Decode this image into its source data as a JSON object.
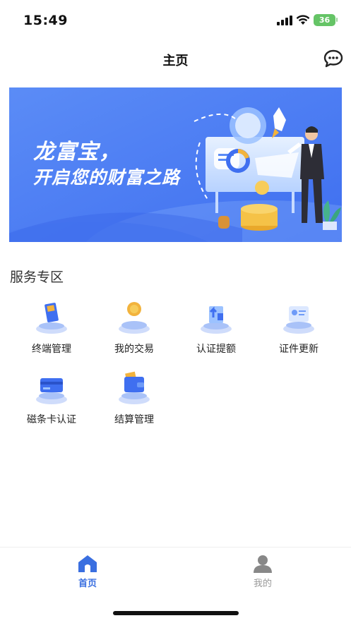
{
  "status_bar": {
    "time": "15:49",
    "battery": "36"
  },
  "nav": {
    "title": "主页"
  },
  "banner": {
    "line1": "龙富宝，",
    "line2": "开启您的财富之路"
  },
  "section": {
    "title": "服务专区",
    "items": [
      {
        "label": "终端管理",
        "icon": "terminal-icon"
      },
      {
        "label": "我的交易",
        "icon": "coin-icon"
      },
      {
        "label": "认证提额",
        "icon": "upload-certify-icon"
      },
      {
        "label": "证件更新",
        "icon": "id-card-icon"
      },
      {
        "label": "磁条卡认证",
        "icon": "bank-card-icon"
      },
      {
        "label": "结算管理",
        "icon": "wallet-icon"
      }
    ]
  },
  "tab_bar": {
    "home": "首页",
    "mine": "我的",
    "active_color": "#3a6fe0",
    "inactive_color": "#999999"
  }
}
